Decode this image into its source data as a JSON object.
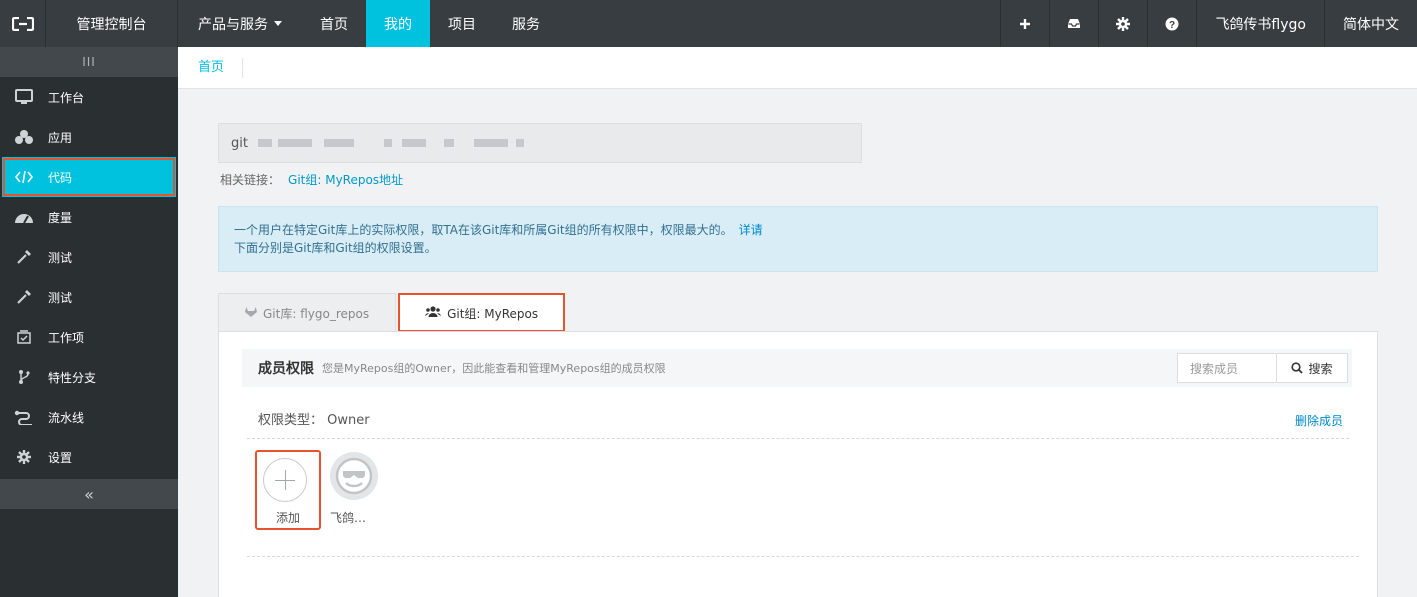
{
  "topbar": {
    "console": "管理控制台",
    "nav": [
      "产品与服务",
      "首页",
      "我的",
      "项目",
      "服务"
    ],
    "active_index": 2,
    "icons": [
      "plus-icon",
      "inbox-icon",
      "gear-icon",
      "help-icon"
    ],
    "user": "飞鸽传书flygo",
    "language": "简体中文"
  },
  "sidebar": {
    "toggle": "III",
    "items": [
      {
        "label": "工作台",
        "icon": "monitor-icon"
      },
      {
        "label": "应用",
        "icon": "cubes-icon"
      },
      {
        "label": "代码",
        "icon": "code-icon"
      },
      {
        "label": "度量",
        "icon": "dashboard-icon"
      },
      {
        "label": "测试",
        "icon": "pipette-icon"
      },
      {
        "label": "测试",
        "icon": "pipette-icon"
      },
      {
        "label": "工作项",
        "icon": "inbox-check-icon"
      },
      {
        "label": "特性分支",
        "icon": "branch-icon"
      },
      {
        "label": "流水线",
        "icon": "pipeline-icon"
      },
      {
        "label": "设置",
        "icon": "gear-icon"
      }
    ],
    "active_index": 2,
    "collapse": "«"
  },
  "breadcrumb": "首页",
  "git": {
    "prefix": "git",
    "related_label": "相关链接：",
    "related_link": "Git组: MyRepos地址"
  },
  "notice": {
    "line1": "一个用户在特定Git库上的实际权限，取TA在该Git库和所属Git组的所有权限中，权限最大的。",
    "detail": "详请",
    "line2": "下面分别是Git库和Git组的权限设置。"
  },
  "tabs": [
    {
      "label": "Git库: flygo_repos",
      "icon": "gitlab-icon"
    },
    {
      "label": "Git组: MyRepos",
      "icon": "users-icon"
    }
  ],
  "members": {
    "title": "成员权限",
    "description": "您是MyRepos组的Owner，因此能查看和管理MyRepos组的成员权限",
    "search_placeholder": "搜索成员",
    "search_button": "搜索",
    "permission_type": "权限类型： Owner",
    "delete": "删除成员",
    "add_label": "添加",
    "list": [
      {
        "name": "飞鸽…"
      }
    ]
  },
  "colors": {
    "accent": "#00c1de",
    "topbar": "#373d41",
    "sidebar": "#2a2f32",
    "highlight": "#e8522f"
  }
}
